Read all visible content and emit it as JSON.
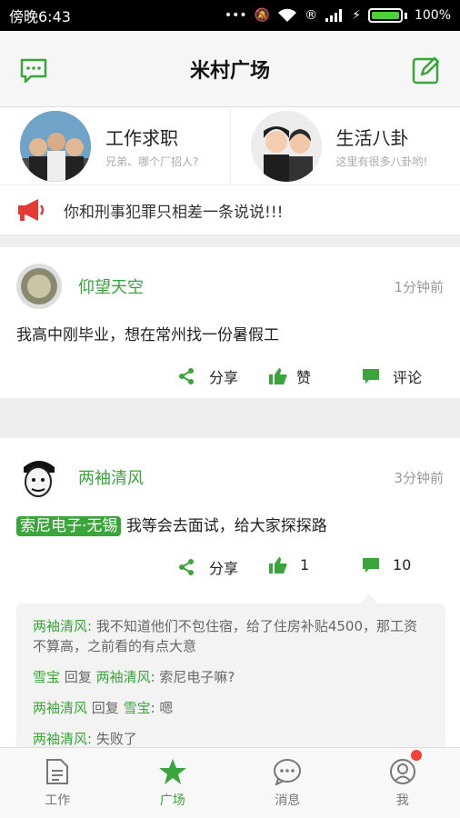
{
  "statusbar": {
    "time": "傍晚6:43",
    "battery": "100%"
  },
  "header": {
    "title": "米村广场"
  },
  "categories": [
    {
      "title": "工作求职",
      "subtitle": "兄弟、哪个厂招人?"
    },
    {
      "title": "生活八卦",
      "subtitle": "这里有很多八卦哟!"
    }
  ],
  "notice": {
    "text": "你和刑事犯罪只相差一条说说!!!"
  },
  "posts": [
    {
      "user": "仰望天空",
      "time": "1分钟前",
      "content": "我高中刚毕业，想在常州找一份暑假工",
      "share": "分享",
      "like": "赞",
      "comment": "评论"
    },
    {
      "user": "两袖清风",
      "time": "3分钟前",
      "tag": "索尼电子·无锡",
      "content": "我等会去面试，给大家探探路",
      "share": "分享",
      "like": "1",
      "comment": "10",
      "comments": [
        {
          "user": "两袖清风",
          "sep": ": ",
          "text": "我不知道他们不包住宿，给了住房补贴4500，那工资不算高，之前看的有点大意"
        },
        {
          "user": "雪宝",
          "reply": " 回复 ",
          "target": "两袖清风",
          "sep": ": ",
          "text": "索尼电子嘛?"
        },
        {
          "user": "两袖清风",
          "reply": " 回复 ",
          "target": "雪宝",
          "sep": ": ",
          "text": "嗯"
        },
        {
          "user": "两袖清风",
          "sep": ": ",
          "text": "失败了"
        }
      ]
    }
  ],
  "tabs": [
    {
      "label": "工作"
    },
    {
      "label": "广场"
    },
    {
      "label": "消息"
    },
    {
      "label": "我"
    }
  ]
}
